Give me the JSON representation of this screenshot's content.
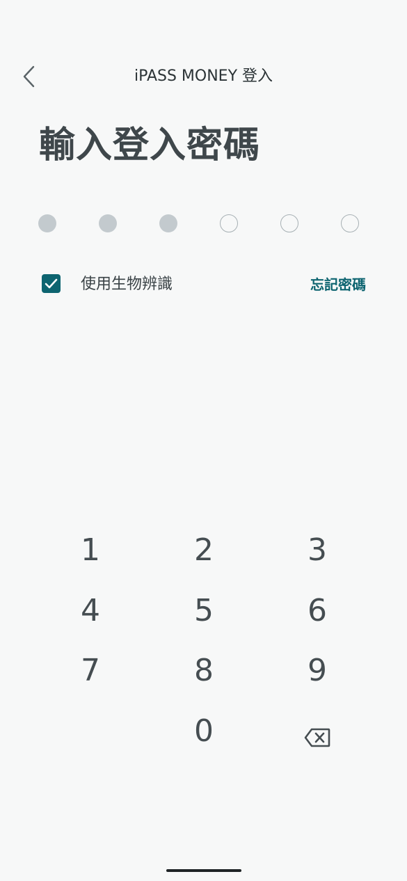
{
  "header": {
    "title": "iPASS MONEY 登入",
    "back_icon": "chevron-left-icon"
  },
  "page": {
    "title": "輸入登入密碼"
  },
  "pin": {
    "length": 6,
    "entered": 3
  },
  "biometric": {
    "checked": true,
    "label": "使用生物辨識",
    "check_icon": "checkmark-icon"
  },
  "forgot": {
    "label": "忘記密碼"
  },
  "keypad": {
    "keys": [
      "1",
      "2",
      "3",
      "4",
      "5",
      "6",
      "7",
      "8",
      "9",
      "0"
    ],
    "backspace_icon": "backspace-icon"
  },
  "colors": {
    "accent": "#0d6470",
    "filled_dot": "#c3cace",
    "empty_dot_border": "#a7b0b4",
    "background": "#f7f8f8"
  }
}
